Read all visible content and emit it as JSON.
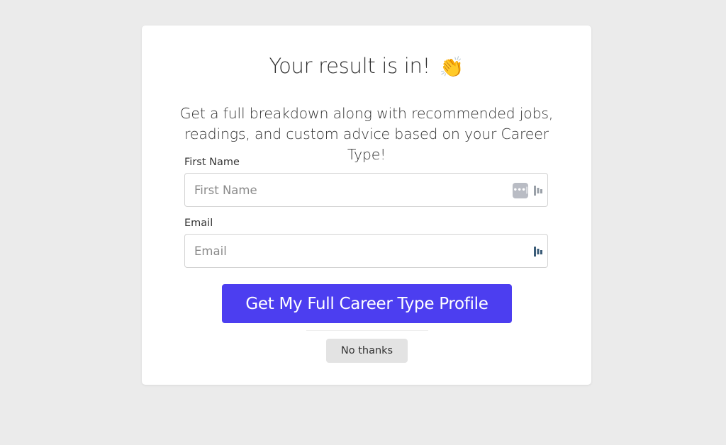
{
  "modal": {
    "title": "Your result is in!",
    "title_emoji": "👏",
    "subtitle": "Get a full breakdown along with recommended jobs, readings, and custom advice based on your Career Type!"
  },
  "form": {
    "first_name": {
      "label": "First Name",
      "placeholder": "First Name",
      "value": ""
    },
    "email": {
      "label": "Email",
      "placeholder": "Email",
      "value": ""
    },
    "submit_label": "Get My Full Career Type Profile",
    "decline_label": "No thanks"
  },
  "icons": {
    "password_manager": "password-dots-icon",
    "autofill_extension": "autofill-extension-icon"
  },
  "colors": {
    "background": "#ebebeb",
    "primary": "#4c3ef0",
    "secondary_button": "#e3e3e3",
    "extension_icon_muted": "#9aa0a8",
    "extension_icon_active": "#3b5c78"
  }
}
